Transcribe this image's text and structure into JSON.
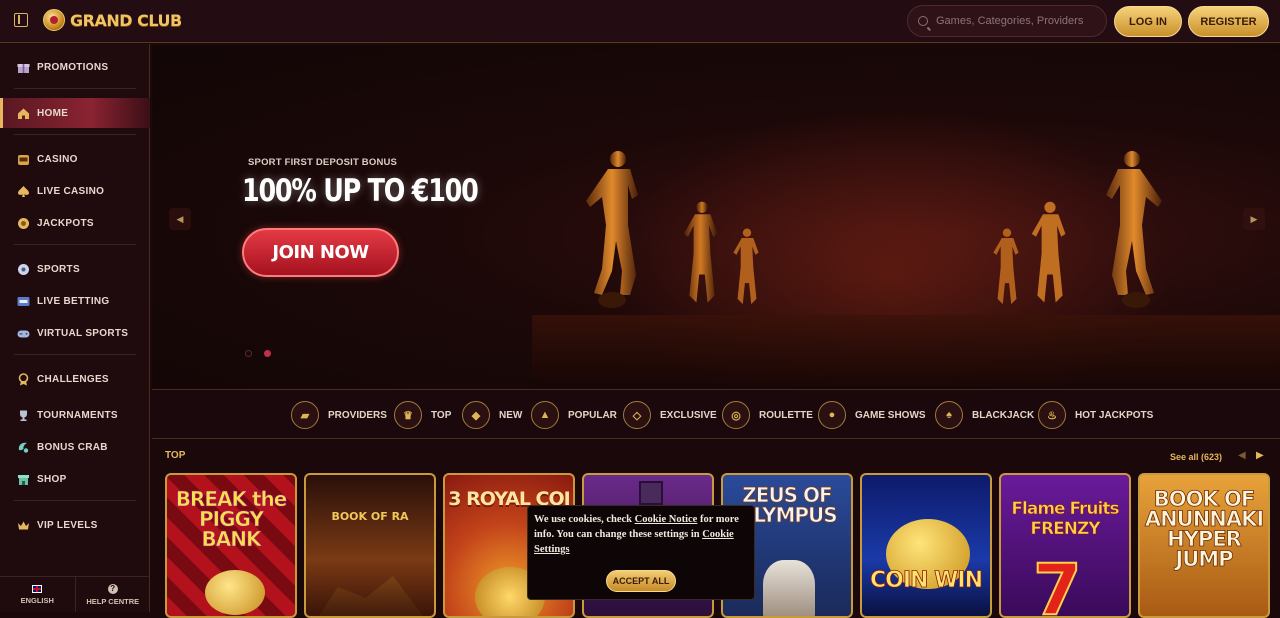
{
  "header": {
    "logo_text": "GRAND CLUB",
    "search_placeholder": "Games, Categories, Providers",
    "login_label": "LOG IN",
    "register_label": "REGISTER"
  },
  "sidebar": {
    "items": [
      {
        "label": "PROMOTIONS",
        "icon": "gift-icon"
      },
      {
        "label": "HOME",
        "icon": "home-icon",
        "active": true
      },
      {
        "label": "CASINO",
        "icon": "slot-machine-icon"
      },
      {
        "label": "LIVE CASINO",
        "icon": "spade-icon"
      },
      {
        "label": "JACKPOTS",
        "icon": "jackpot-icon"
      },
      {
        "label": "SPORTS",
        "icon": "soccer-ball-icon"
      },
      {
        "label": "LIVE BETTING",
        "icon": "live-icon"
      },
      {
        "label": "VIRTUAL SPORTS",
        "icon": "gamepad-icon"
      },
      {
        "label": "CHALLENGES",
        "icon": "medal-icon"
      },
      {
        "label": "TOURNAMENTS",
        "icon": "trophy-icon"
      },
      {
        "label": "BONUS CRAB",
        "icon": "claw-icon"
      },
      {
        "label": "SHOP",
        "icon": "shop-icon"
      },
      {
        "label": "VIP LEVELS",
        "icon": "crown-icon"
      }
    ],
    "footer": {
      "language_label": "ENGLISH",
      "help_label": "HELP CENTRE"
    }
  },
  "hero": {
    "eyebrow": "SPORT FIRST DEPOSIT BONUS",
    "title": "100% UP TO €100",
    "cta_label": "JOIN NOW",
    "slide_count": 2,
    "active_slide": 2
  },
  "categories": [
    {
      "label": "PROVIDERS",
      "icon": "folder-icon"
    },
    {
      "label": "TOP",
      "icon": "crown-icon"
    },
    {
      "label": "NEW",
      "icon": "tag-icon"
    },
    {
      "label": "POPULAR",
      "icon": "thumbs-up-icon"
    },
    {
      "label": "EXCLUSIVE",
      "icon": "diamond-icon"
    },
    {
      "label": "ROULETTE",
      "icon": "roulette-icon"
    },
    {
      "label": "GAME SHOWS",
      "icon": "microphone-icon"
    },
    {
      "label": "BLACKJACK",
      "icon": "spade-icon"
    },
    {
      "label": "HOT JACKPOTS",
      "icon": "flame-icon"
    }
  ],
  "games_section": {
    "title": "TOP",
    "see_all_label": "See all (623)",
    "tiles": [
      {
        "name": "BREAK the PIGGY BANK"
      },
      {
        "name": "BOOK OF RA"
      },
      {
        "name": "3 ROYAL COI"
      },
      {
        "name": ""
      },
      {
        "name": "ZEUS OF OLYMPUS"
      },
      {
        "name": "COIN WIN"
      },
      {
        "name": "Flame Fruits FRENZY"
      },
      {
        "name": "BOOK OF ANUNNAKI HYPER JUMP"
      }
    ]
  },
  "cookie_banner": {
    "text_1": "We use cookies, check ",
    "link_notice": "Cookie Notice",
    "text_2": " for more info. You can change these settings in ",
    "link_settings": "Cookie Settings",
    "accept_label": "ACCEPT ALL"
  },
  "colors": {
    "accent_gold": "#e5b75f",
    "cta_red": "#c8212e",
    "background": "#1a080b"
  }
}
